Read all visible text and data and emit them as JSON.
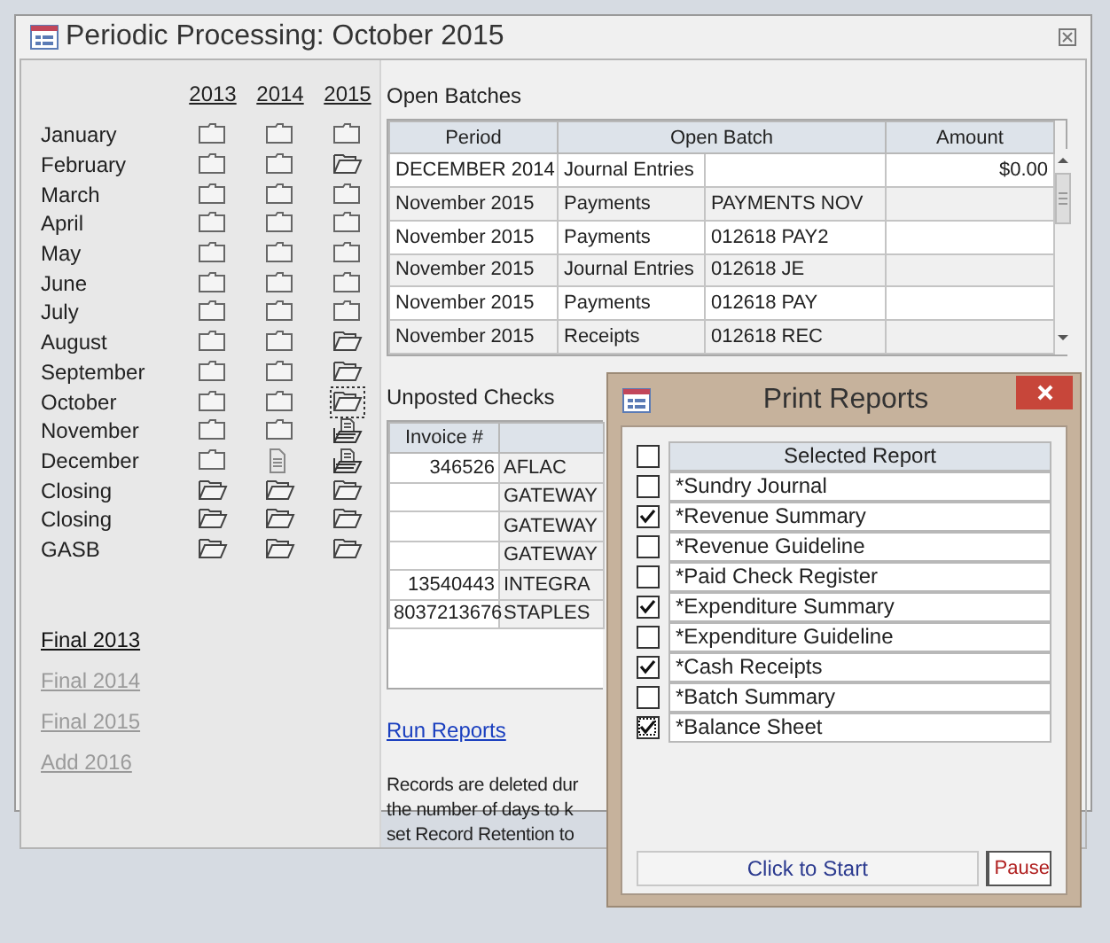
{
  "window": {
    "title": "Periodic Processing: October 2015"
  },
  "periods": {
    "years": [
      "2013",
      "2014",
      "2015"
    ],
    "rows": [
      {
        "label": "January",
        "cells": [
          {
            "kind": "closed",
            "focused": false
          },
          {
            "kind": "closed",
            "focused": false
          },
          {
            "kind": "closed",
            "focused": false
          }
        ]
      },
      {
        "label": "February",
        "cells": [
          {
            "kind": "closed",
            "focused": false
          },
          {
            "kind": "closed",
            "focused": false
          },
          {
            "kind": "open",
            "focused": false
          }
        ]
      },
      {
        "label": "March",
        "cells": [
          {
            "kind": "closed",
            "focused": false
          },
          {
            "kind": "closed",
            "focused": false
          },
          {
            "kind": "closed",
            "focused": false
          }
        ]
      },
      {
        "label": "April",
        "cells": [
          {
            "kind": "closed",
            "focused": false
          },
          {
            "kind": "closed",
            "focused": false
          },
          {
            "kind": "closed",
            "focused": false
          }
        ]
      },
      {
        "label": "May",
        "cells": [
          {
            "kind": "closed",
            "focused": false
          },
          {
            "kind": "closed",
            "focused": false
          },
          {
            "kind": "closed",
            "focused": false
          }
        ]
      },
      {
        "label": "June",
        "cells": [
          {
            "kind": "closed",
            "focused": false
          },
          {
            "kind": "closed",
            "focused": false
          },
          {
            "kind": "closed",
            "focused": false
          }
        ]
      },
      {
        "label": "July",
        "cells": [
          {
            "kind": "closed",
            "focused": false
          },
          {
            "kind": "closed",
            "focused": false
          },
          {
            "kind": "closed",
            "focused": false
          }
        ]
      },
      {
        "label": "August",
        "cells": [
          {
            "kind": "closed",
            "focused": false
          },
          {
            "kind": "closed",
            "focused": false
          },
          {
            "kind": "open",
            "focused": false
          }
        ]
      },
      {
        "label": "September",
        "cells": [
          {
            "kind": "closed",
            "focused": false
          },
          {
            "kind": "closed",
            "focused": false
          },
          {
            "kind": "open",
            "focused": false
          }
        ]
      },
      {
        "label": "October",
        "cells": [
          {
            "kind": "closed",
            "focused": false
          },
          {
            "kind": "closed",
            "focused": false
          },
          {
            "kind": "open",
            "focused": true
          }
        ]
      },
      {
        "label": "November",
        "cells": [
          {
            "kind": "closed",
            "focused": false
          },
          {
            "kind": "closed",
            "focused": false
          },
          {
            "kind": "open-document",
            "focused": false
          }
        ]
      },
      {
        "label": "December",
        "cells": [
          {
            "kind": "closed",
            "focused": false
          },
          {
            "kind": "document",
            "focused": false
          },
          {
            "kind": "open-document",
            "focused": false
          }
        ]
      },
      {
        "label": "Closing",
        "cells": [
          {
            "kind": "open",
            "focused": false
          },
          {
            "kind": "open",
            "focused": false
          },
          {
            "kind": "open",
            "focused": false
          }
        ]
      },
      {
        "label": "Closing",
        "cells": [
          {
            "kind": "open",
            "focused": false
          },
          {
            "kind": "open",
            "focused": false
          },
          {
            "kind": "open",
            "focused": false
          }
        ]
      },
      {
        "label": "GASB",
        "cells": [
          {
            "kind": "open",
            "focused": false
          },
          {
            "kind": "open",
            "focused": false
          },
          {
            "kind": "open",
            "focused": false
          }
        ]
      }
    ]
  },
  "year_links": [
    {
      "label": "Final 2013",
      "disabled": false
    },
    {
      "label": "Final 2014",
      "disabled": true
    },
    {
      "label": "Final 2015",
      "disabled": true
    },
    {
      "label": "Add 2016",
      "disabled": true
    }
  ],
  "open_batches": {
    "title": "Open Batches",
    "columns": [
      "Period",
      "Open Batch",
      "Amount"
    ],
    "rows": [
      {
        "period": "DECEMBER 2014",
        "batch_type": "Journal Entries",
        "amount": "$0.00"
      },
      {
        "period": "November 2015",
        "batch_type": "Payments",
        "batch_name": "PAYMENTS NOV"
      },
      {
        "period": "November 2015",
        "batch_type": "Payments",
        "batch_name": "012618 PAY2"
      },
      {
        "period": "November 2015",
        "batch_type": "Journal Entries",
        "batch_name": "012618 JE"
      },
      {
        "period": "November 2015",
        "batch_type": "Payments",
        "batch_name": "012618 PAY"
      },
      {
        "period": "November 2015",
        "batch_type": "Receipts",
        "batch_name": "012618 REC"
      }
    ]
  },
  "unposted_checks": {
    "title": "Unposted Checks",
    "columns": [
      "Invoice #"
    ],
    "rows": [
      [
        "346526",
        "AFLAC"
      ],
      [
        "",
        "GATEWAY"
      ],
      [
        "",
        "GATEWAY"
      ],
      [
        "",
        "GATEWAY"
      ],
      [
        "13540443",
        "INTEGRA"
      ],
      [
        "8037213676",
        "STAPLES"
      ]
    ]
  },
  "run_reports_link": "Run Reports",
  "note_lines": [
    "Records are deleted dur",
    "the number of days to k",
    "set Record Retention to"
  ],
  "print_reports": {
    "title": "Print Reports",
    "header": "Selected Report",
    "all_checked": false,
    "reports": [
      {
        "name": "*Sundry Journal",
        "checked": false,
        "focused": false
      },
      {
        "name": "*Revenue Summary",
        "checked": true,
        "focused": false
      },
      {
        "name": "*Revenue Guideline",
        "checked": false,
        "focused": false
      },
      {
        "name": "*Paid Check Register",
        "checked": false,
        "focused": false
      },
      {
        "name": "*Expenditure Summary",
        "checked": true,
        "focused": false
      },
      {
        "name": "*Expenditure Guideline",
        "checked": false,
        "focused": false
      },
      {
        "name": "*Cash Receipts",
        "checked": true,
        "focused": false
      },
      {
        "name": "*Batch Summary",
        "checked": false,
        "focused": false
      },
      {
        "name": "*Balance Sheet",
        "checked": true,
        "focused": true
      }
    ],
    "start_button": "Click to Start",
    "pause_button": "Pause"
  }
}
